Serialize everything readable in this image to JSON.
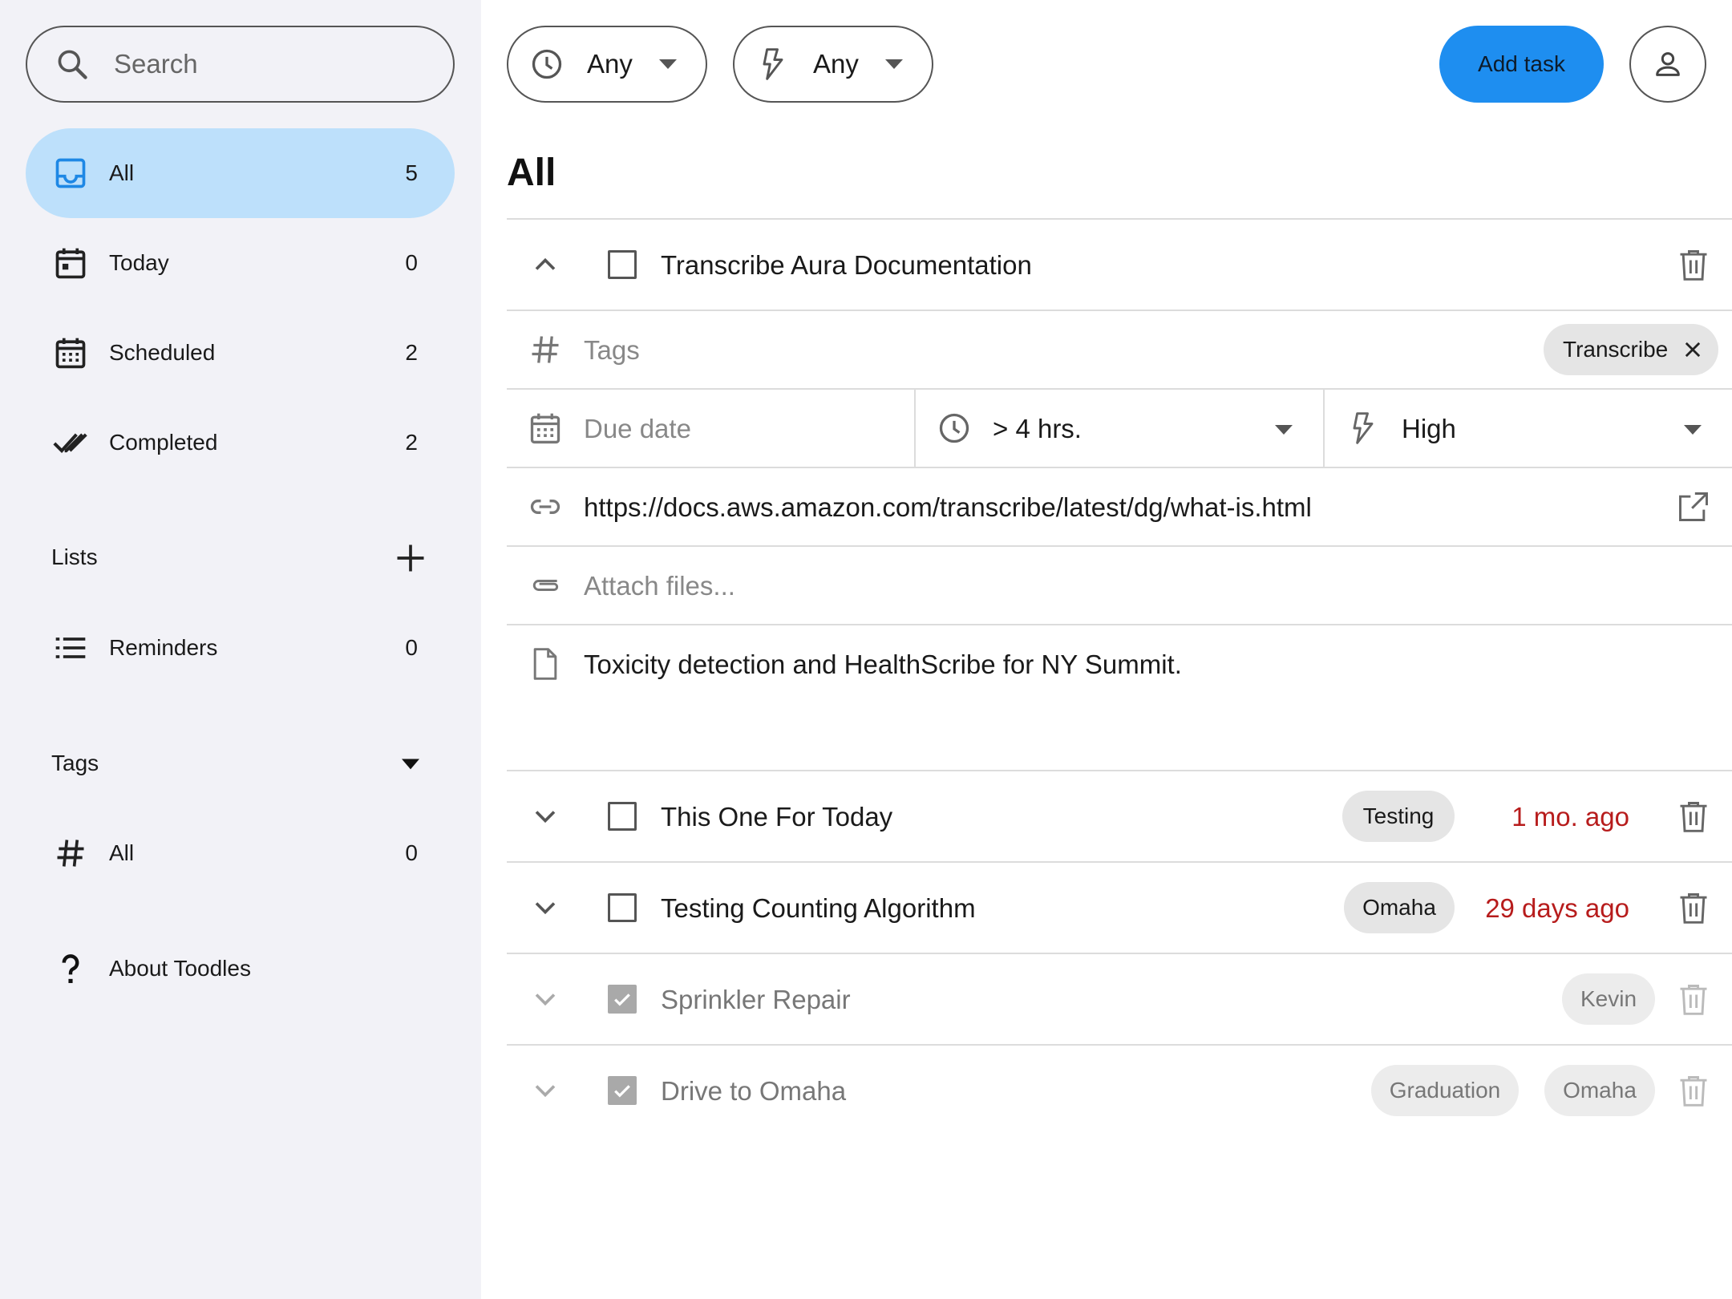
{
  "sidebar": {
    "search_placeholder": "Search",
    "nav": [
      {
        "label": "All",
        "count": "5",
        "icon": "inbox-icon",
        "active": true
      },
      {
        "label": "Today",
        "count": "0",
        "icon": "calendar-today-icon"
      },
      {
        "label": "Scheduled",
        "count": "2",
        "icon": "calendar-month-icon"
      },
      {
        "label": "Completed",
        "count": "2",
        "icon": "double-check-icon"
      }
    ],
    "lists_heading": "Lists",
    "lists": [
      {
        "label": "Reminders",
        "count": "0",
        "icon": "list-icon"
      }
    ],
    "tags_heading": "Tags",
    "tags": [
      {
        "label": "All",
        "count": "0",
        "icon": "hash-icon"
      }
    ],
    "about_label": "About Toodles"
  },
  "toolbar": {
    "time_filter": "Any",
    "priority_filter": "Any",
    "add_task_label": "Add task"
  },
  "main": {
    "title": "All",
    "expanded_task": {
      "title": "Transcribe Aura Documentation",
      "tags_placeholder": "Tags",
      "tag": "Transcribe",
      "due_date_placeholder": "Due date",
      "duration": "> 4 hrs.",
      "priority": "High",
      "link": "https://docs.aws.amazon.com/transcribe/latest/dg/what-is.html",
      "attach_placeholder": "Attach files...",
      "notes": "Toxicity detection and HealthScribe for NY Summit."
    },
    "tasks": [
      {
        "title": "This One For Today",
        "tags": [
          "Testing"
        ],
        "due": "1 mo. ago",
        "done": false
      },
      {
        "title": "Testing Counting Algorithm",
        "tags": [
          "Omaha"
        ],
        "due": "29 days ago",
        "done": false
      },
      {
        "title": "Sprinkler Repair",
        "tags": [
          "Kevin"
        ],
        "due": "",
        "done": true
      },
      {
        "title": "Drive to Omaha",
        "tags": [
          "Graduation",
          "Omaha"
        ],
        "due": "",
        "done": true
      }
    ]
  },
  "colors": {
    "accent": "#1e8ef0",
    "active_nav_bg": "#bde0fb",
    "sidebar_bg": "#f2f2f7",
    "overdue": "#b71c1c"
  }
}
